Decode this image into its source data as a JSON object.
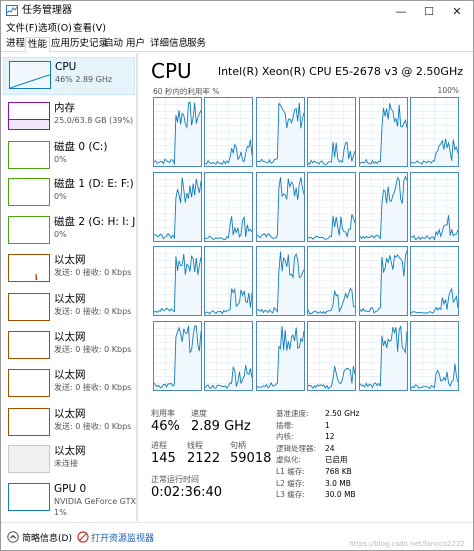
{
  "window": {
    "title": "任务管理器"
  },
  "window_controls": {
    "minimize": "—",
    "maximize": "☐",
    "close": "✕"
  },
  "menu": [
    "文件(F)",
    "选项(O)",
    "查看(V)"
  ],
  "tabs": [
    "进程",
    "性能",
    "应用历史记录",
    "启动",
    "用户",
    "详细信息",
    "服务"
  ],
  "active_tab": "性能",
  "sidebar": [
    {
      "name": "CPU",
      "sub": "46% 2.89 GHz",
      "color": "#117dbb",
      "selected": true
    },
    {
      "name": "内存",
      "sub": "25.0/63.8 GB (39%)",
      "color": "#8b12ae"
    },
    {
      "name": "磁盘 0 (C:)",
      "sub": "0%",
      "color": "#4da60c"
    },
    {
      "name": "磁盘 1 (D: E: F:)",
      "sub": "0%",
      "color": "#4da60c"
    },
    {
      "name": "磁盘 2 (G: H: I: J:)",
      "sub": "0%",
      "color": "#4da60c"
    },
    {
      "name": "以太网",
      "sub": "发送: 0 接收: 0 Kbps",
      "color": "#a74f01"
    },
    {
      "name": "以太网",
      "sub": "发送: 0 接收: 0 Kbps",
      "color": "#a74f01"
    },
    {
      "name": "以太网",
      "sub": "发送: 0 接收: 0 Kbps",
      "color": "#a74f01"
    },
    {
      "name": "以太网",
      "sub": "发送: 0 接收: 0 Kbps",
      "color": "#a74f01"
    },
    {
      "name": "以太网",
      "sub": "发送: 0 接收: 0 Kbps",
      "color": "#a74f01"
    },
    {
      "name": "以太网",
      "sub": "未连接",
      "color": "#a74f01"
    },
    {
      "name": "GPU 0",
      "sub": "NVIDIA GeForce GTX",
      "sub2": "1%",
      "color": "#117dbb"
    }
  ],
  "main": {
    "title": "CPU",
    "model": "Intel(R) Xeon(R) CPU E5-2678 v3 @ 2.50GHz",
    "util_label": "60 秒内的利用率 %",
    "util_max": "100%"
  },
  "stats": {
    "util_label": "利用率",
    "util_value": "46%",
    "speed_label": "速度",
    "speed_value": "2.89 GHz",
    "proc_label": "进程",
    "proc_value": "145",
    "thread_label": "线程",
    "thread_value": "2122",
    "handle_label": "句柄",
    "handle_value": "59018",
    "uptime_label": "正常运行时间",
    "uptime_value": "0:02:36:40"
  },
  "details": [
    {
      "k": "基准速度:",
      "v": "2.50 GHz"
    },
    {
      "k": "插槽:",
      "v": "1"
    },
    {
      "k": "内核:",
      "v": "12"
    },
    {
      "k": "逻辑处理器:",
      "v": "24"
    },
    {
      "k": "虚拟化:",
      "v": "已启用"
    },
    {
      "k": "L1 缓存:",
      "v": "768 KB"
    },
    {
      "k": "L2 缓存:",
      "v": "3.0 MB"
    },
    {
      "k": "L3 缓存:",
      "v": "30.0 MB"
    }
  ],
  "footer": {
    "brief": "简略信息(D)",
    "monitor": "打开资源监视器"
  },
  "watermark": "https://blog.csdn.net/fancco2222",
  "colors": {
    "cpu": "#117dbb",
    "grid_border": "#4a8bbf",
    "grid_fill": "#d9eaf7"
  }
}
